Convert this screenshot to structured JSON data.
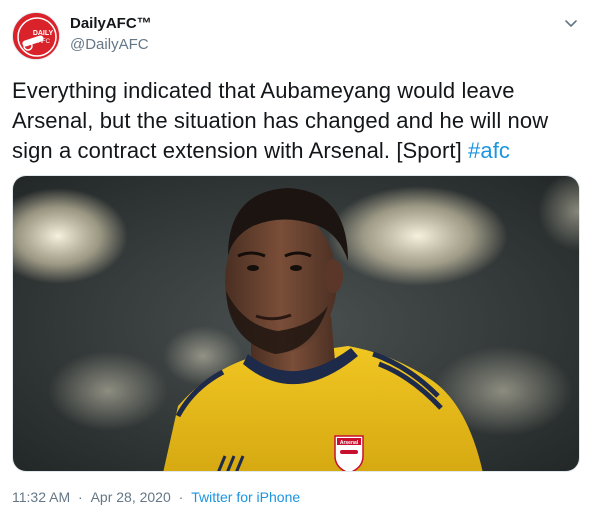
{
  "user": {
    "display_name": "DailyAFC™",
    "handle": "@DailyAFC",
    "avatar_text_top": "DAILY",
    "avatar_text_bottom": "AFC"
  },
  "tweet": {
    "text_before_hashtag": "Everything indicated that Aubameyang would leave Arsenal, but the situation has changed and he will now sign a contract extension with Arsenal. [Sport] ",
    "hashtag": "#afc"
  },
  "media": {
    "description_icon": "player-photo",
    "crest_text": "Arsenal"
  },
  "meta": {
    "time": "11:32 AM",
    "date": "Apr 28, 2020",
    "source": "Twitter for iPhone"
  },
  "colors": {
    "link": "#1b95e0",
    "text": "#14171a",
    "secondary": "#657786",
    "brand": "#d9222a"
  },
  "icons": {
    "menu": "chevron-down-icon"
  }
}
